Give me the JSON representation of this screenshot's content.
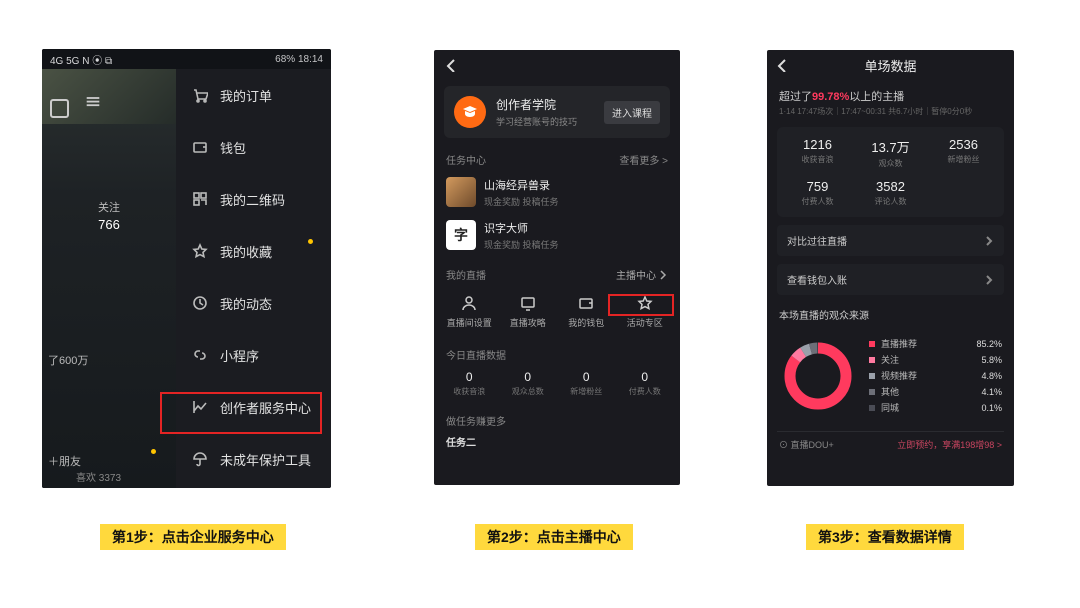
{
  "statusbar": {
    "signal": "4G 5G N ⦿ ⧉",
    "battery": "68%",
    "time": "18:14"
  },
  "step1": {
    "follow_label": "关注",
    "follow_count": "766",
    "likes_line": "了600万",
    "add_friend": "＋朋友",
    "bottom_likes": "喜欢 3373",
    "menu": {
      "orders": "我的订单",
      "wallet": "钱包",
      "qr": "我的二维码",
      "favorites": "我的收藏",
      "moments": "我的动态",
      "miniapp": "小程序",
      "creator": "创作者服务中心",
      "minor": "未成年保护工具"
    }
  },
  "step2": {
    "academy": {
      "title": "创作者学院",
      "sub": "学习经营账号的技巧",
      "btn": "进入课程"
    },
    "task_center": {
      "title": "任务中心",
      "more": "查看更多 >"
    },
    "task1": {
      "title": "山海经异兽录",
      "sub": "现金奖励  投稿任务"
    },
    "task2": {
      "title": "识字大师",
      "char": "字",
      "sub": "现金奖励  投稿任务"
    },
    "mylive": {
      "title": "我的直播",
      "link": "主播中心"
    },
    "icons": {
      "settings": "直播间设置",
      "guide": "直播攻略",
      "wallet": "我的钱包",
      "activity": "活动专区"
    },
    "today_title": "今日直播数据",
    "stats": {
      "income_v": "0",
      "income_l": "收获音浪",
      "viewers_v": "0",
      "viewers_l": "观众总数",
      "newfans_v": "0",
      "newfans_l": "新增粉丝",
      "paying_v": "0",
      "paying_l": "付费人数"
    },
    "more_title": "做任务赚更多",
    "task_label": "任务二"
  },
  "step3": {
    "title": "单场数据",
    "surpass_pre": "超过了",
    "surpass_pct": "99.78%",
    "surpass_post": "以上的主播",
    "sub": "1·14 17:47场次｜17:47~00:31 共6.7小时｜暂停0分0秒",
    "grid": [
      {
        "v": "1216",
        "l": "收获音浪"
      },
      {
        "v": "13.7万",
        "l": "观众数"
      },
      {
        "v": "2536",
        "l": "新增粉丝"
      },
      {
        "v": "759",
        "l": "付费人数"
      },
      {
        "v": "3582",
        "l": "评论人数"
      }
    ],
    "row1": "对比过往直播",
    "row2": "查看钱包入账",
    "source_title": "本场直播的观众来源",
    "legend": [
      {
        "label": "直播推荐",
        "value": "85.2%",
        "color": "#ff3a5e"
      },
      {
        "label": "关注",
        "value": "5.8%",
        "color": "#ff7aa0"
      },
      {
        "label": "视频推荐",
        "value": "4.8%",
        "color": "#9aa0aa"
      },
      {
        "label": "其他",
        "value": "4.1%",
        "color": "#6d6f78"
      },
      {
        "label": "同城",
        "value": "0.1%",
        "color": "#4a4c55"
      }
    ],
    "dou_title": "⊙ 直播DOU+",
    "dou_link": "立即预约，享满198增98 >"
  },
  "captions": {
    "c1": "第1步：点击企业服务中心",
    "c2": "第2步：点击主播中心",
    "c3": "第3步：查看数据详情"
  }
}
